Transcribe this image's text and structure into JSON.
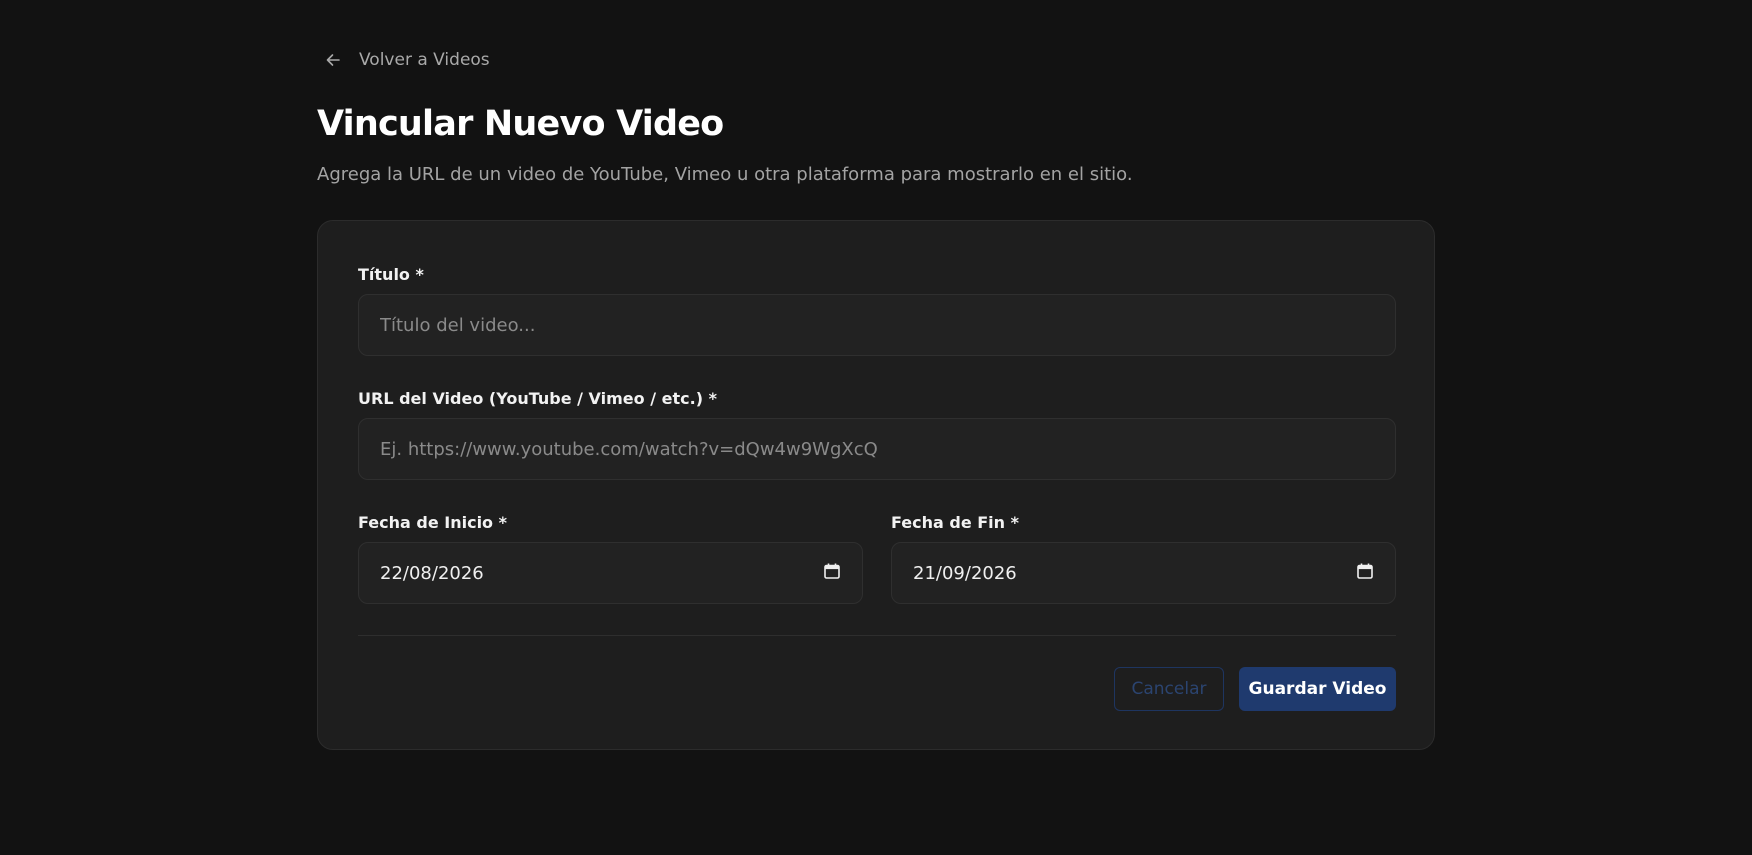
{
  "header": {
    "back_label": "Volver a Videos",
    "title": "Vincular Nuevo Video",
    "subtitle": "Agrega la URL de un video de YouTube, Vimeo u otra plataforma para mostrarlo en el sitio."
  },
  "form": {
    "title_field": {
      "label": "Título *",
      "value": "",
      "placeholder": "Título del video..."
    },
    "url_field": {
      "label": "URL del Video (YouTube / Vimeo / etc.) *",
      "value": "",
      "placeholder": "Ej. https://www.youtube.com/watch?v=dQw4w9WgXcQ"
    },
    "start_date": {
      "label": "Fecha de Inicio *",
      "value": "22/08/2026"
    },
    "end_date": {
      "label": "Fecha de Fin *",
      "value": "21/09/2026"
    }
  },
  "actions": {
    "cancel_label": "Cancelar",
    "save_label": "Guardar Video"
  },
  "icons": {
    "back": "arrow-left-icon",
    "calendar": "calendar-icon"
  },
  "colors": {
    "background": "#121212",
    "card": "#1e1e1e",
    "primary": "#1f3a6e"
  }
}
